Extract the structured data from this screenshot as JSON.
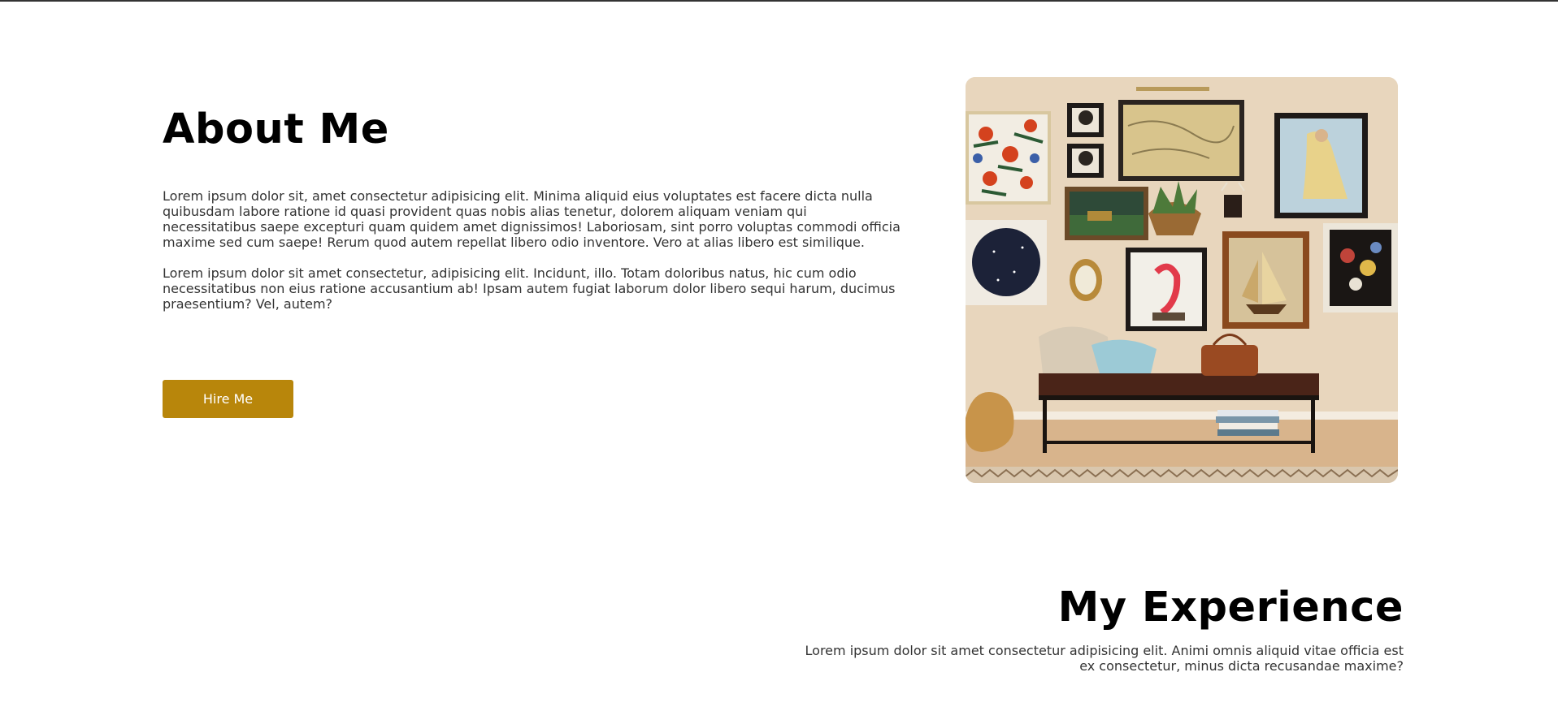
{
  "about": {
    "title": "About Me",
    "paragraphs": [
      "Lorem ipsum dolor sit, amet consectetur adipisicing elit. Minima aliquid eius voluptates est facere dicta nulla quibusdam labore ratione id quasi provident quas nobis alias tenetur, dolorem aliquam veniam qui necessitatibus saepe excepturi quam quidem amet dignissimos! Laboriosam, sint porro voluptas commodi officia maxime sed cum saepe! Rerum quod autem repellat libero odio inventore. Vero at alias libero est similique.",
      "Lorem ipsum dolor sit amet consectetur, adipisicing elit. Incidunt, illo. Totam doloribus natus, hic cum odio necessitatibus non eius ratione accusantium ab! Ipsam autem fugiat laborum dolor libero sequi harum, ducimus praesentium? Vel, autem?"
    ],
    "button_label": "Hire Me",
    "button_color": "#b8860b"
  },
  "experience": {
    "title": "My Experience",
    "description": "Lorem ipsum dolor sit amet consectetur adipisicing elit. Animi omnis aliquid vitae officia est ex consectetur, minus dicta recusandae maxime?"
  }
}
